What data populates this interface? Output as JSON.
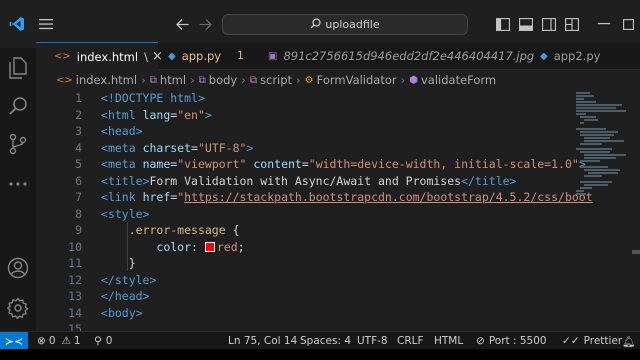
{
  "titlebar": {
    "search_text": "uploadfile",
    "search_icon": "search-icon",
    "logo_color": "#2aa1ff"
  },
  "tabs": [
    {
      "label": "index.html",
      "icon": "html-file-icon",
      "icon_glyph": "<>",
      "modified": "\\",
      "close": "×",
      "active": true
    },
    {
      "label": "app.py",
      "icon": "python-file-icon",
      "badge": "1",
      "active": false
    },
    {
      "label": "891c2756615d946edd2df2e446404417.jpg",
      "icon": "image-file-icon",
      "active": false
    },
    {
      "label": "app2.py",
      "icon": "python-file-icon",
      "active": false
    }
  ],
  "breadcrumb": [
    "index.html",
    "html",
    "body",
    "script",
    "FormValidator",
    "validateForm"
  ],
  "editor": {
    "line_numbers": [
      "1",
      "2",
      "3",
      "4",
      "5",
      "6",
      "7",
      "8",
      "9",
      "10",
      "11",
      "12",
      "13",
      "14",
      "15"
    ],
    "lines": {
      "l1a": "<!DOCTYPE ",
      "l1b": "html",
      "l1c": ">",
      "l2a": "<",
      "l2b": "html",
      "l2c": " lang",
      "l2d": "=",
      "l2e": "\"en\"",
      "l2f": ">",
      "l3a": "<",
      "l3b": "head",
      "l3c": ">",
      "l4a": "<",
      "l4b": "meta",
      "l4c": " charset",
      "l4d": "=",
      "l4e": "\"UTF-8\"",
      "l4f": ">",
      "l5a": "<",
      "l5b": "meta",
      "l5c": " name",
      "l5d": "=",
      "l5e": "\"viewport\"",
      "l5f": " content",
      "l5g": "=",
      "l5h": "\"width=device-width, initial-scale=1.0\"",
      "l5i": ">",
      "l6a": "<",
      "l6b": "title",
      "l6c": ">",
      "l6d": "Form Validation with Async/Await and Promises",
      "l6e": "</",
      "l6f": "title",
      "l6g": ">",
      "l7a": "<",
      "l7b": "link",
      "l7c": " href",
      "l7d": "=",
      "l7e": "\"",
      "l7f": "https://stackpath.bootstrapcdn.com/bootstrap/4.5.2/css/boot",
      "l8a": "<",
      "l8b": "style",
      "l8c": ">",
      "l9a": ".error-message",
      "l9b": " {",
      "l10a": "color",
      "l10b": ": ",
      "l10c": "red",
      "l10d": ";",
      "l11a": "}",
      "l12a": "</",
      "l12b": "style",
      "l12c": ">",
      "l13a": "</",
      "l13b": "head",
      "l13c": ">",
      "l14a": "<",
      "l14b": "body",
      "l14c": ">"
    }
  },
  "statusbar": {
    "errors": "0",
    "warnings": "1",
    "ports_count": "0",
    "cursor": "Ln 75, Col 14",
    "spaces": "Spaces: 4",
    "encoding": "UTF-8",
    "eol": "CRLF",
    "language": "HTML",
    "port": "Port : 5500",
    "prettier": "Prettier"
  }
}
